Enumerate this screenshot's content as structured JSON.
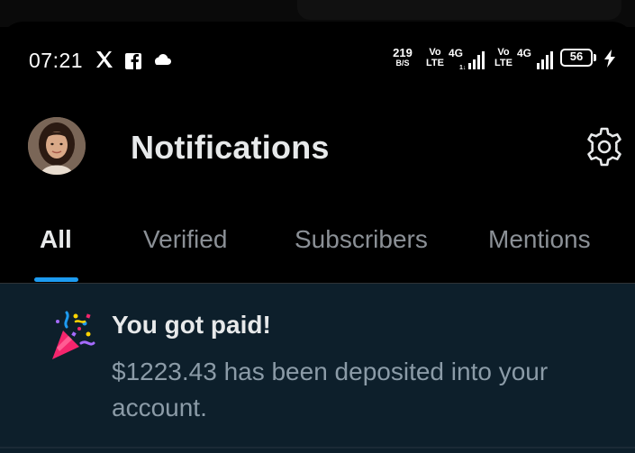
{
  "status_bar": {
    "time": "07:21",
    "notification_icons": [
      "x-logo-icon",
      "facebook-icon",
      "cloud-icon"
    ],
    "net_speed_value": "219",
    "net_speed_unit": "B/S",
    "sim1": {
      "volte_top": "Vo",
      "volte_bottom": "LTE",
      "network": "4G",
      "signal_bars": 4
    },
    "sim2": {
      "volte_top": "Vo",
      "volte_bottom": "LTE",
      "network": "4G",
      "signal_bars": 4
    },
    "battery_level": "56",
    "charging": true
  },
  "header": {
    "title": "Notifications",
    "avatar_icon": "avatar",
    "settings_icon": "gear-icon"
  },
  "tabs": [
    {
      "label": "All",
      "active": true
    },
    {
      "label": "Verified",
      "active": false
    },
    {
      "label": "Subscribers",
      "active": false
    },
    {
      "label": "Mentions",
      "active": false
    }
  ],
  "notification": {
    "icon": "party-popper-icon",
    "title": "You got paid!",
    "body": "$1223.43 has been deposited into your account."
  },
  "colors": {
    "background": "#000000",
    "accent": "#1d9bf0",
    "card_background": "#0d1f2b",
    "muted_text": "#8b9096"
  }
}
